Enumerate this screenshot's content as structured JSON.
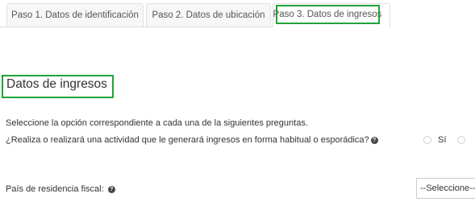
{
  "tabs": [
    {
      "label": "Paso 1. Datos de identificación"
    },
    {
      "label": "Paso 2. Datos de ubicación"
    },
    {
      "label": "Paso 3. Datos de ingresos",
      "active": true
    }
  ],
  "section": {
    "title": "Datos de ingresos",
    "instructions": "Seleccione la opción correspondiente a cada una de la siguientes preguntas."
  },
  "question": {
    "text": "¿Realiza o realizará una actividad que le generará ingresos en forma habitual o esporádica?",
    "help_icon": "help-circle-icon",
    "options": [
      {
        "label": "Sí",
        "selected": false
      },
      {
        "label": "",
        "selected": false
      }
    ]
  },
  "country": {
    "label": "País de residencia fiscal:",
    "help_icon": "help-circle-icon",
    "selected_value": "--Seleccione--"
  },
  "colors": {
    "highlight": "#22a33a",
    "text": "#333333"
  }
}
